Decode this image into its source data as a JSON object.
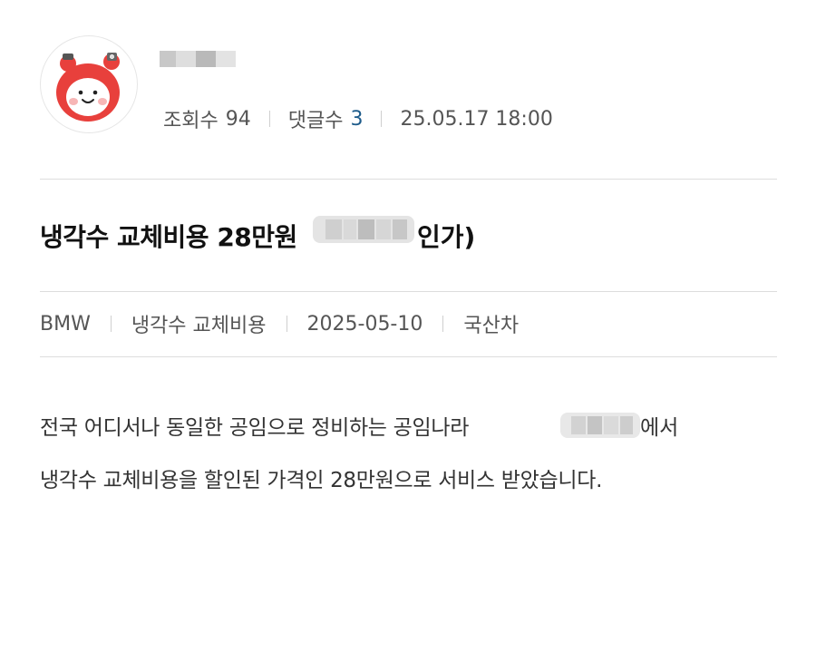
{
  "post": {
    "stats": {
      "views_label": "조회수",
      "views_value": "94",
      "comments_label": "댓글수",
      "comments_value": "3",
      "datetime": "25.05.17 18:00"
    },
    "title_visible": "냉각수 교체비용 28만원",
    "title_tail": "인가)",
    "tags": [
      "BMW",
      "냉각수 교체비용",
      "2025-05-10",
      "국산차"
    ],
    "body": {
      "line1": "전국 어디서나 동일한 공임으로 정비하는 공임나라",
      "line1_tail": "에서",
      "line2": "냉각수 교체비용을 할인된 가격인 28만원으로 서비스 받았습니다."
    }
  },
  "colors": {
    "accent_count": "#1d5b8a",
    "avatar_red": "#e8403c",
    "divider": "#dddddd"
  },
  "icons": {
    "avatar": "red-hood-mascot-icon"
  }
}
